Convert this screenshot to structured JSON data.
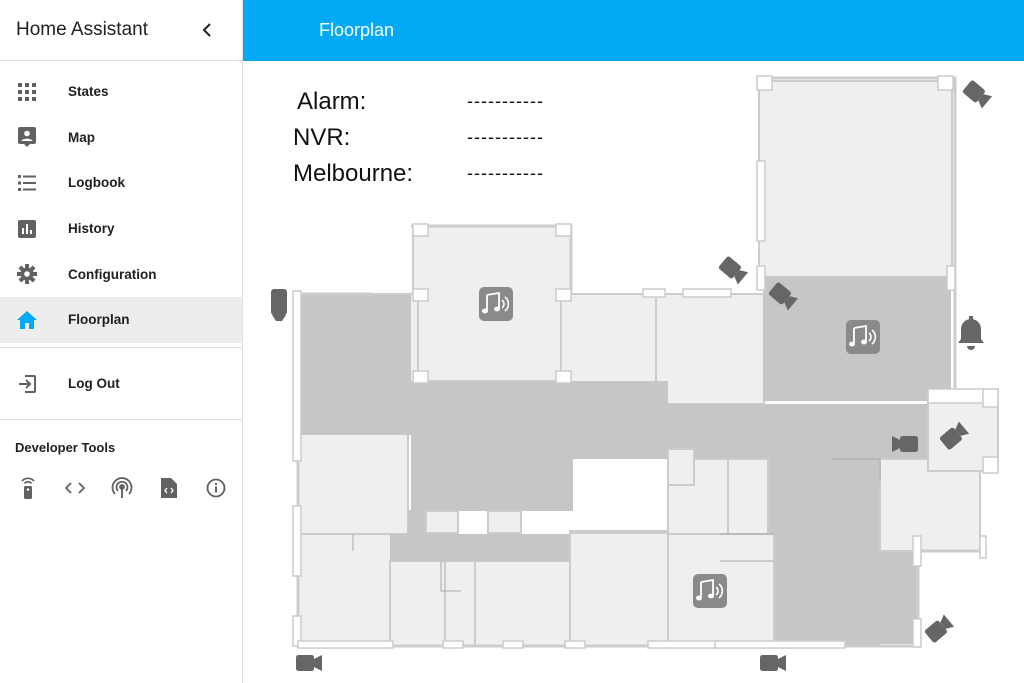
{
  "app": {
    "title": "Home Assistant"
  },
  "sidebar": {
    "items": [
      {
        "label": "States",
        "icon": "apps-icon"
      },
      {
        "label": "Map",
        "icon": "map-account-icon"
      },
      {
        "label": "Logbook",
        "icon": "format-list-icon"
      },
      {
        "label": "History",
        "icon": "chart-bar-icon"
      },
      {
        "label": "Configuration",
        "icon": "gear-icon"
      },
      {
        "label": "Floorplan",
        "icon": "home-icon",
        "active": true
      }
    ],
    "logout": {
      "label": "Log Out",
      "icon": "logout-icon"
    },
    "developer_tools": {
      "title": "Developer Tools",
      "tools": [
        "remote-icon",
        "code-icon",
        "broadcast-icon",
        "file-code-icon",
        "info-icon"
      ]
    }
  },
  "header": {
    "title": "Floorplan"
  },
  "floorplan": {
    "status": [
      {
        "label": "Alarm:",
        "value": "-----------"
      },
      {
        "label": "NVR:",
        "value": "-----------"
      },
      {
        "label": "Melbourne:",
        "value": "-----------"
      }
    ],
    "colors": {
      "accent": "#03a9f4",
      "room_light": "#efefef",
      "room_dark": "#c6c6c6",
      "wall": "#cccccc",
      "device": "#666666",
      "active_nav_icon": "#03a9f4"
    }
  }
}
